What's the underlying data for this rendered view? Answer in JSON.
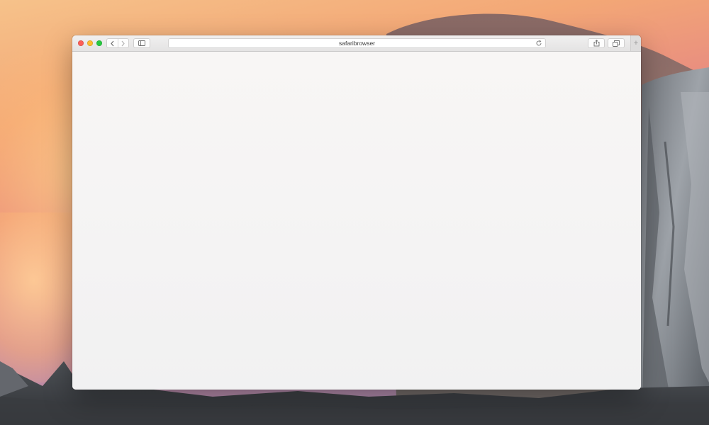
{
  "browser": {
    "address_text": "safaribrowser",
    "new_tab_label": "+"
  },
  "icons": {
    "back": "chevron-left-icon",
    "forward": "chevron-right-icon",
    "sidebar": "sidebar-icon",
    "reload": "reload-icon",
    "share": "share-icon",
    "tabs": "tabs-overview-icon"
  },
  "colors": {
    "close": "#fc5f57",
    "minimize": "#fdbc2e",
    "maximize": "#28c840"
  }
}
